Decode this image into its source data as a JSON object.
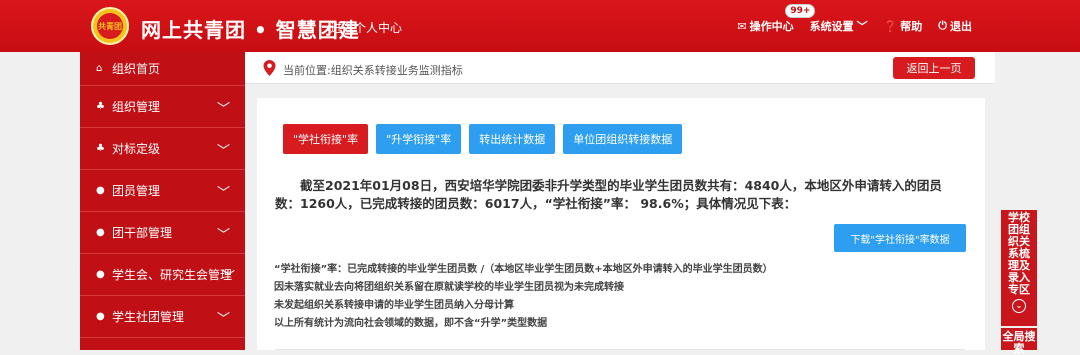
{
  "header": {
    "logo_text": "共青团",
    "title": "网上共青团 • 智慧团建",
    "personal_link": "进入个人中心",
    "nav": {
      "ops_center": "操作中心",
      "badge": "99+",
      "settings": "系统设置",
      "help": "帮助",
      "logout": "退出"
    }
  },
  "sidebar": {
    "items": [
      {
        "label": "组织首页",
        "icon": "home-icon"
      },
      {
        "label": "组织管理",
        "icon": "sitemap-icon"
      },
      {
        "label": "对标定级",
        "icon": "sitemap-icon"
      },
      {
        "label": "团员管理",
        "icon": "users-icon"
      },
      {
        "label": "团干部管理",
        "icon": "users-icon"
      },
      {
        "label": "学生会、研究生会管理",
        "icon": "users-icon"
      },
      {
        "label": "学生社团管理",
        "icon": "users-icon"
      }
    ]
  },
  "breadcrumb": {
    "text": "当前位置:组织关系转接业务监测指标",
    "back_label": "返回上一页"
  },
  "tabs": [
    "\"学社衔接\"率",
    "\"升学衔接\"率",
    "转出统计数据",
    "单位团组织转接数据"
  ],
  "summary": "截至2021年01月08日，西安培华学院团委非升学类型的毕业学生团员数共有：4840人，本地区外申请转入的团员数：1260人，已完成转接的团员数：6017人，“学社衔接”率： 98.6%；具体情况见下表：",
  "download_label": "下载\"学社衔接\"率数据",
  "notes": [
    "“学社衔接”率：已完成转接的毕业学生团员数 /（本地区毕业学生团员数+本地区外申请转入的毕业学生团员数）",
    "因未落实就业去向将团组织关系留在原就读学校的毕业学生团员视为未完成转接",
    "未发起组织关系转接申请的毕业学生团员纳入分母计算",
    "以上所有统计为流向社会领域的数据，即不含“升学”类型数据"
  ],
  "float_panel": {
    "label": "学校团组织关系梳理及录入专区",
    "label2": "全局搜索"
  },
  "colors": {
    "brand_red": "#c80d12",
    "accent_blue": "#2e9ff0"
  }
}
